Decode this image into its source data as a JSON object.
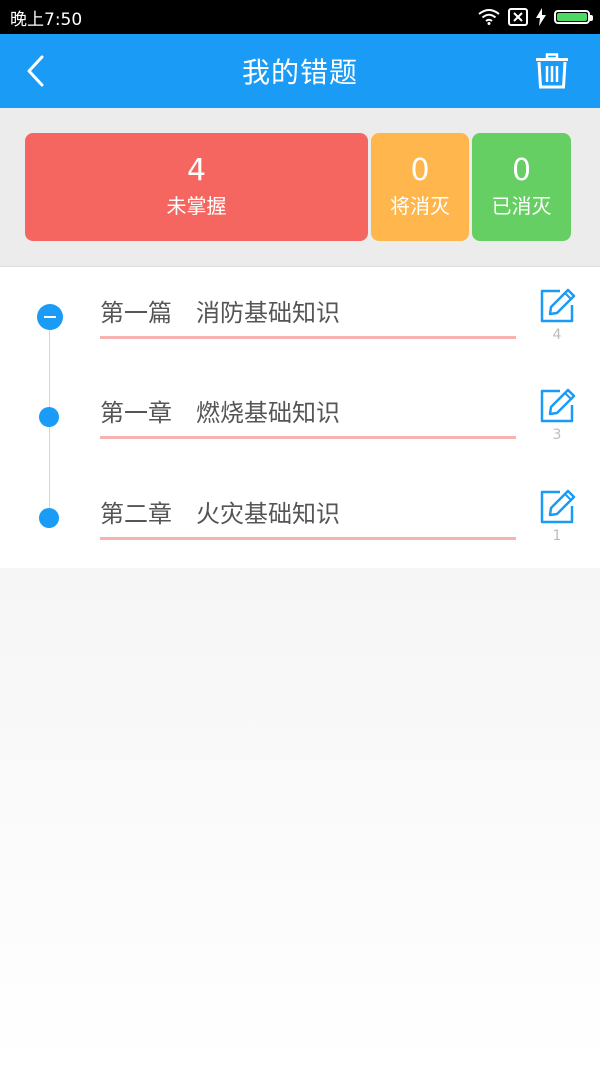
{
  "status_bar": {
    "time": "晚上7:50"
  },
  "header": {
    "title": "我的错题"
  },
  "summary": {
    "unmastered": {
      "count": "4",
      "label": "未掌握"
    },
    "to_eliminate": {
      "count": "0",
      "label": "将消灭"
    },
    "eliminated": {
      "count": "0",
      "label": "已消灭"
    }
  },
  "chapters": [
    {
      "title": "第一篇　消防基础知识",
      "count": "4"
    },
    {
      "title": "第一章　燃烧基础知识",
      "count": "3"
    },
    {
      "title": "第二章　火灾基础知识",
      "count": "1"
    }
  ],
  "colors": {
    "primary": "#1a9bf6",
    "red": "#f4665f",
    "orange": "#feb64d",
    "green": "#66cf63",
    "underline": "#f6b3b0"
  }
}
